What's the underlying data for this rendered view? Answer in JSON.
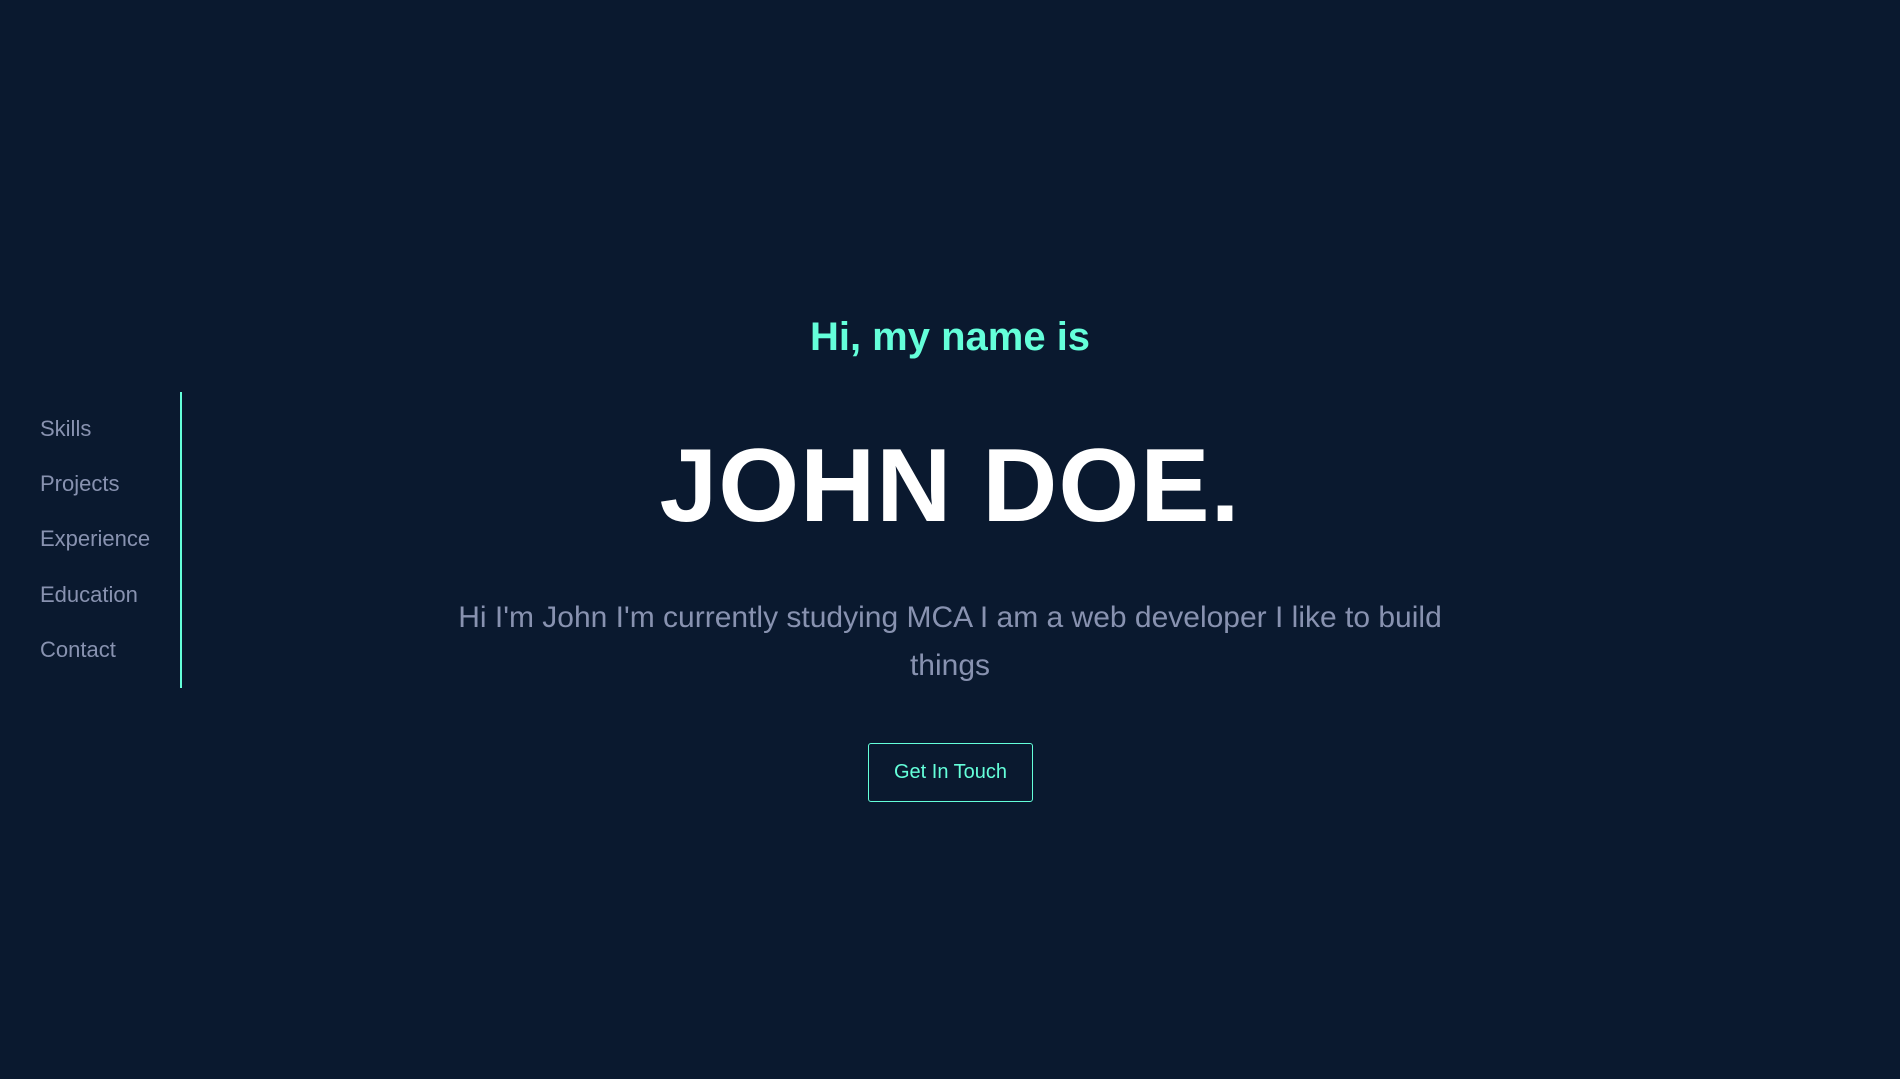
{
  "sidebar": {
    "items": [
      {
        "label": "Skills"
      },
      {
        "label": "Projects"
      },
      {
        "label": "Experience"
      },
      {
        "label": "Education"
      },
      {
        "label": "Contact"
      }
    ]
  },
  "hero": {
    "greeting": "Hi, my name is",
    "name": "JOHN DOE.",
    "intro": "Hi I'm John I'm currently studying MCA I am a web developer I like to build things",
    "cta_label": "Get In Touch"
  },
  "colors": {
    "background": "#0a192f",
    "accent": "#64ffda",
    "muted_text": "#8892b0",
    "heading": "#ffffff"
  }
}
